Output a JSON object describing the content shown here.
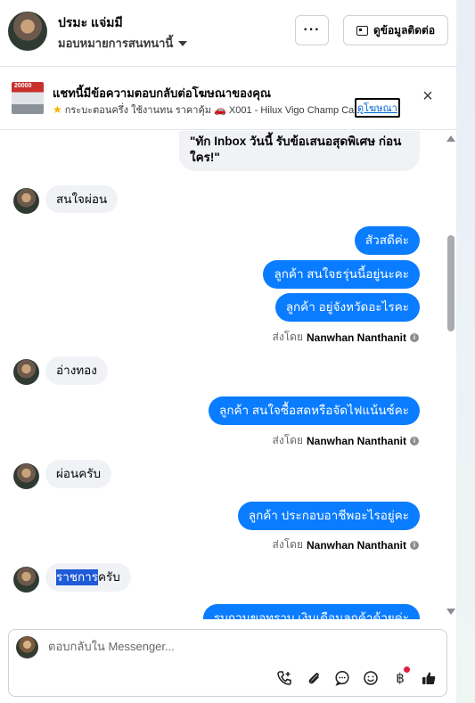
{
  "header": {
    "contact_name": "ปรมะ แจ่มมี",
    "page_name": "มอบหมายการสนทนานี้",
    "more_label": "···",
    "contact_info_button": "ดูข้อมูลติดต่อ"
  },
  "ad_banner": {
    "title": "แชทนี้มีข้อความตอบกลับต่อโฆษณาของคุณ",
    "thumb_text": "20000",
    "description": "กระบะตอนครึ่ง ใช้งานทน ราคาคุ้ม 🚗 X001 - Hilux Vigo Champ Cab...",
    "link_label": "ดูโฆษณา",
    "close_icon": "close-icon"
  },
  "messages": {
    "m1": "\"ทัก Inbox วันนี้ รับข้อเสนอสุดพิเศษ ก่อน",
    "m1b": "ใคร!\"",
    "m2": "สนใจผ่อน",
    "m3": "สัวสดีค่ะ",
    "m4": "ลูกค้า สนใจธรุ่นนี้อยู่นะคะ",
    "m5": "ลูกค้า อยู่จังหวัดอะไรคะ",
    "sent_prefix": "ส่งโดย",
    "sent_name": "Nanwhan Nanthanit",
    "m6": "อ่างทอง",
    "m7": "ลูกค้า สนใจซื้อสดหรือจัดไฟแน้นซ์คะ",
    "m8": "ผ่อนครับ",
    "m9": "ลูกค้า ประกอบอาชีพอะไรอยู่คะ",
    "m10_highlight": "ราชการ",
    "m10_rest": "ครับ",
    "m11_partial": "รบกวนขอทราบ เงินเดือนลูกค้าด้วยค่ะ"
  },
  "composer": {
    "placeholder": "ตอบกลับใน Messenger...",
    "tools": [
      "call-add-icon",
      "paperclip-icon",
      "chat-bubble-icon",
      "emoji-icon",
      "baht-icon",
      "thumbs-up-icon"
    ]
  },
  "colors": {
    "outgoing": "#0a7cff",
    "incoming": "#f0f2f5",
    "highlight": "#1f5bd6"
  }
}
